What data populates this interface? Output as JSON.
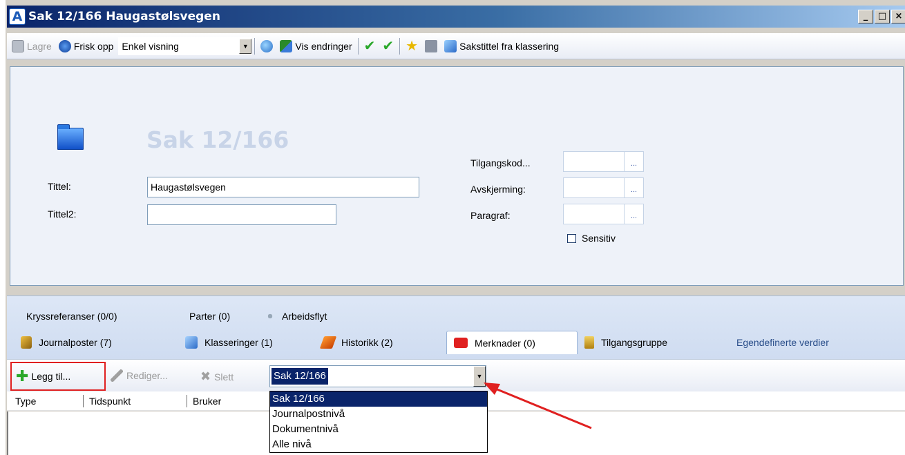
{
  "window": {
    "logo": "A",
    "title": "Sak 12/166 Haugastølsvegen",
    "min_glyph": "_",
    "max_glyph": "□",
    "close_glyph": "×"
  },
  "toolbar": {
    "save_label": "Lagre",
    "refresh_label": "Frisk opp",
    "view_select_value": "Enkel visning",
    "changes_label": "Vis endringer",
    "case_title_label": "Sakstittel fra klassering"
  },
  "form": {
    "heading": "Sak 12/166",
    "tittel_label": "Tittel:",
    "tittel_value": "Haugastølsvegen",
    "tittel2_label": "Tittel2:",
    "tittel2_value": "",
    "access_code_label": "Tilgangskod...",
    "shielding_label": "Avskjerming:",
    "paragraph_label": "Paragraf:",
    "lookup_button": "...",
    "sensitive_label": "Sensitiv"
  },
  "tabs": {
    "row1": [
      "Kryssreferanser (0/0)",
      "Parter (0)",
      "Arbeidsflyt"
    ],
    "row2": [
      "Journalposter (7)",
      "Klasseringer (1)",
      "Historikk (2)",
      "Merknader (0)",
      "Tilgangsgruppe",
      "Egendefinerte verdier"
    ]
  },
  "subtoolbar": {
    "add_label": "Legg til...",
    "edit_label": "Rediger...",
    "delete_label": "Slett",
    "level_value": "Sak 12/166",
    "level_options": [
      "Sak 12/166",
      "Journalpostnivå",
      "Dokumentnivå",
      "Alle nivå"
    ]
  },
  "grid": {
    "columns": [
      "Type",
      "Tidspunkt",
      "Bruker"
    ]
  },
  "colors": {
    "annotation": "#e02020",
    "selection": "#0a246a",
    "titlebar": "#0a246a"
  }
}
